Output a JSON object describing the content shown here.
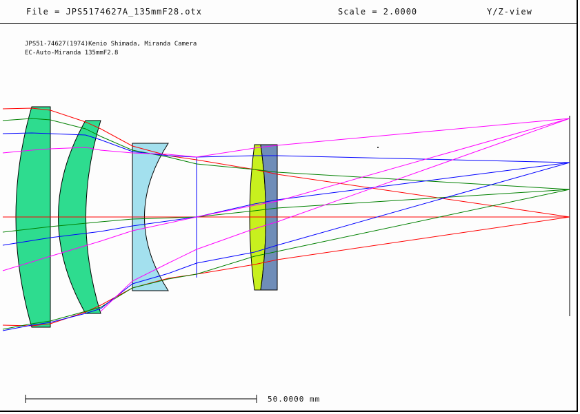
{
  "header": {
    "file": "File = JPS5174627A_135mmF28.otx",
    "scale": "Scale = 2.0000",
    "view": "Y/Z-view"
  },
  "description": {
    "line1": "JPS51-74627(1974)Kenio Shimada, Miranda Camera",
    "line2": "EC-Auto-Miranda 135mmF2.8"
  },
  "scale_bar": {
    "label": "50.0000 mm"
  },
  "colors": {
    "lens1": "#2edc8f",
    "lens2": "#2edc8f",
    "lens3": "#a3e0ee",
    "lens4": "#c8f01e",
    "lens5": "#6f8db8",
    "ray_axial": "#ff0000",
    "ray_mid": "#008000",
    "ray_field": "#0000ff",
    "ray_edge": "#ff00ff"
  }
}
